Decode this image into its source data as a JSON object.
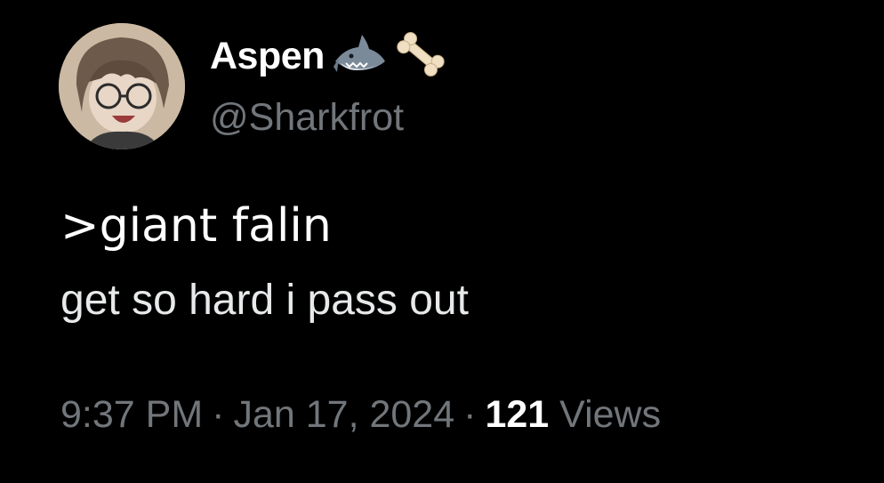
{
  "author": {
    "display_name": "Aspen",
    "handle": "@Sharkfrot",
    "name_emojis": [
      "shark-icon",
      "bone-icon"
    ]
  },
  "tweet": {
    "line1": ">giant falin",
    "line2": "get so hard i pass out"
  },
  "meta": {
    "time": "9:37 PM",
    "separator": "·",
    "date": "Jan 17, 2024",
    "views_count": "121",
    "views_label": "Views"
  },
  "colors": {
    "background": "#000000",
    "primary_text": "#e7e9ea",
    "secondary_text": "#71767b"
  }
}
